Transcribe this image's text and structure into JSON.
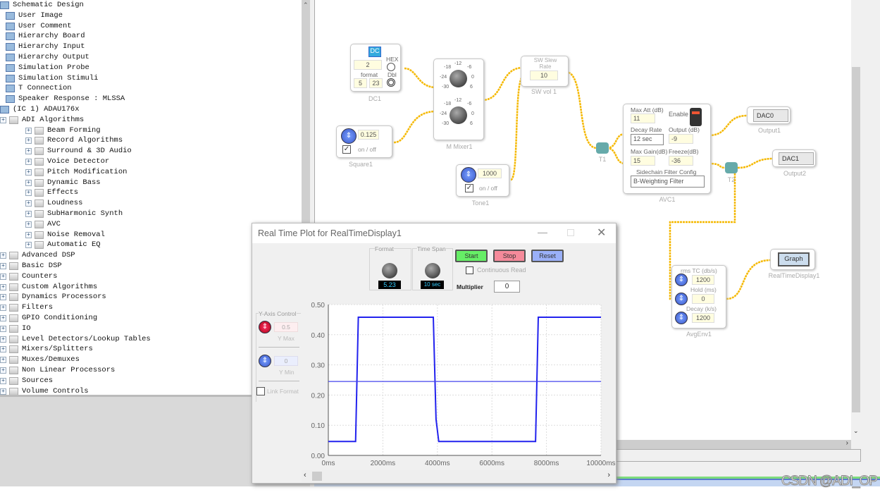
{
  "tree": {
    "items": [
      {
        "label": "Schematic Design",
        "level": 0,
        "icon": "schematic-icon"
      },
      {
        "label": "User Image",
        "level": 1,
        "icon": "image-icon"
      },
      {
        "label": "User Comment",
        "level": 1,
        "icon": "comment-icon"
      },
      {
        "label": "Hierarchy Board",
        "level": 1,
        "icon": "board-icon"
      },
      {
        "label": "Hierarchy Input",
        "level": 1,
        "icon": "input-icon"
      },
      {
        "label": "Hierarchy Output",
        "level": 1,
        "icon": "output-icon"
      },
      {
        "label": "Simulation Probe",
        "level": 1,
        "icon": "probe-icon"
      },
      {
        "label": "Simulation Stimuli",
        "level": 1,
        "icon": "stimuli-icon"
      },
      {
        "label": "T Connection",
        "level": 1,
        "icon": "t-connection-icon"
      },
      {
        "label": "Speaker Response : MLSSA",
        "level": 1,
        "icon": "speaker-icon"
      },
      {
        "label": "(IC 1) ADAU176x",
        "level": 0,
        "icon": "chip-icon"
      },
      {
        "label": "ADI Algorithms",
        "level": 1,
        "icon": "folder-icon"
      },
      {
        "label": "Beam Forming",
        "level": 2,
        "icon": "folder-icon"
      },
      {
        "label": "Record Algorithms",
        "level": 2,
        "icon": "folder-icon"
      },
      {
        "label": "Surround & 3D Audio",
        "level": 2,
        "icon": "folder-icon"
      },
      {
        "label": "Voice Detector",
        "level": 2,
        "icon": "folder-icon"
      },
      {
        "label": "Pitch Modification",
        "level": 2,
        "icon": "folder-icon"
      },
      {
        "label": "Dynamic Bass",
        "level": 2,
        "icon": "folder-icon"
      },
      {
        "label": "Effects",
        "level": 2,
        "icon": "folder-icon"
      },
      {
        "label": "Loudness",
        "level": 2,
        "icon": "folder-icon"
      },
      {
        "label": "SubHarmonic Synth",
        "level": 2,
        "icon": "folder-icon"
      },
      {
        "label": "AVC",
        "level": 2,
        "icon": "folder-icon"
      },
      {
        "label": "Noise Removal",
        "level": 2,
        "icon": "folder-icon"
      },
      {
        "label": "Automatic EQ",
        "level": 2,
        "icon": "folder-icon"
      },
      {
        "label": "Advanced DSP",
        "level": 1,
        "icon": "folder-icon"
      },
      {
        "label": "Basic DSP",
        "level": 1,
        "icon": "folder-icon"
      },
      {
        "label": "Counters",
        "level": 1,
        "icon": "folder-icon"
      },
      {
        "label": "Custom Algorithms",
        "level": 1,
        "icon": "folder-icon"
      },
      {
        "label": "Dynamics Processors",
        "level": 1,
        "icon": "folder-icon"
      },
      {
        "label": "Filters",
        "level": 1,
        "icon": "folder-icon"
      },
      {
        "label": "GPIO Conditioning",
        "level": 1,
        "icon": "folder-icon"
      },
      {
        "label": "IO",
        "level": 1,
        "icon": "folder-icon"
      },
      {
        "label": "Level Detectors/Lookup Tables",
        "level": 1,
        "icon": "folder-icon"
      },
      {
        "label": "Mixers/Splitters",
        "level": 1,
        "icon": "folder-icon"
      },
      {
        "label": "Muxes/Demuxes",
        "level": 1,
        "icon": "folder-icon"
      },
      {
        "label": "Non Linear Processors",
        "level": 1,
        "icon": "folder-icon"
      },
      {
        "label": "Sources",
        "level": 1,
        "icon": "folder-icon"
      },
      {
        "label": "Volume Controls",
        "level": 1,
        "icon": "folder-icon"
      }
    ]
  },
  "blocks": {
    "dc": {
      "name": "DC1",
      "icon_text": "DC",
      "value": "2",
      "format_label": "format",
      "fmt_a": "5",
      "fmt_b": "23",
      "hex": "HEX",
      "dbl": "Dbl"
    },
    "mixer": {
      "name": "M Mixer1",
      "ticks": [
        "-12",
        "-18",
        "-6",
        "-24",
        "0",
        "-30",
        "6"
      ]
    },
    "square": {
      "name": "Square1",
      "value": "0.125",
      "toggle": "on / off"
    },
    "tone": {
      "name": "Tone1",
      "value": "1000",
      "toggle": "on / off"
    },
    "swvol": {
      "name": "SW vol 1",
      "title": "SW Slew Rate",
      "value": "10"
    },
    "t1": {
      "name": "T1"
    },
    "t2": {
      "name": "T2"
    },
    "avc": {
      "name": "AVC1",
      "max_att_label": "Max Att (dB)",
      "max_att": "11",
      "enable": "Enable",
      "decay_label": "Decay Rate",
      "decay": "12 sec",
      "output_label": "Output (dB)",
      "output": "-9",
      "max_gain_label": "Max Gain(dB)",
      "max_gain": "15",
      "freeze_label": "Freeze(dB)",
      "freeze": "-36",
      "sidechain_label": "Sidechain Filter Config",
      "sidechain": "B-Weighting Filter"
    },
    "out1": {
      "name": "Output1",
      "value": "DAC0"
    },
    "out2": {
      "name": "Output2",
      "value": "DAC1"
    },
    "avgenv": {
      "name": "AvgEnv1",
      "rms_label": "rms TC (db/s)",
      "rms": "1200",
      "hold_label": "Hold (ms)",
      "hold": "0",
      "decay_label": "Decay (k/s)",
      "decay": "1200"
    },
    "rtd": {
      "name": "RealTimeDisplay1",
      "button": "Graph"
    }
  },
  "dialog": {
    "title": "Real Time Plot for RealTimeDisplay1",
    "format_label": "Format",
    "format_value": "5.23",
    "timespan_label": "Time Span",
    "timespan_value": "10 sec",
    "start": "Start",
    "stop": "Stop",
    "reset": "Reset",
    "continuous_read": "Continuous Read",
    "continuous_checked": false,
    "multiplier_label": "Multiplier",
    "multiplier": "0",
    "yaxis_label": "Y-Axis Control",
    "ymax": "0.5",
    "ymax_label": "Y Max",
    "ymin": "0",
    "ymin_label": "Y Min",
    "link_format": "Link Format",
    "link_checked": false
  },
  "chart_data": {
    "type": "line",
    "xlim": [
      0,
      10000
    ],
    "ylim": [
      0,
      0.5
    ],
    "xticks": [
      "0ms",
      "2000ms",
      "4000ms",
      "6000ms",
      "8000ms",
      "10000ms"
    ],
    "yticks": [
      "0.00",
      "0.10",
      "0.20",
      "0.30",
      "0.40",
      "0.50"
    ],
    "grid": true,
    "series": [
      {
        "color": "#2222ee",
        "x": [
          0,
          1000,
          1100,
          3850,
          3950,
          4050,
          7600,
          7700,
          10000
        ],
        "y": [
          0.046,
          0.046,
          0.458,
          0.458,
          0.12,
          0.046,
          0.046,
          0.458,
          0.458
        ]
      },
      {
        "color": "#4444ee",
        "x": [
          0,
          10000
        ],
        "y": [
          0.245,
          0.245
        ]
      }
    ]
  },
  "watermark": "CSDN @ADI_OP"
}
